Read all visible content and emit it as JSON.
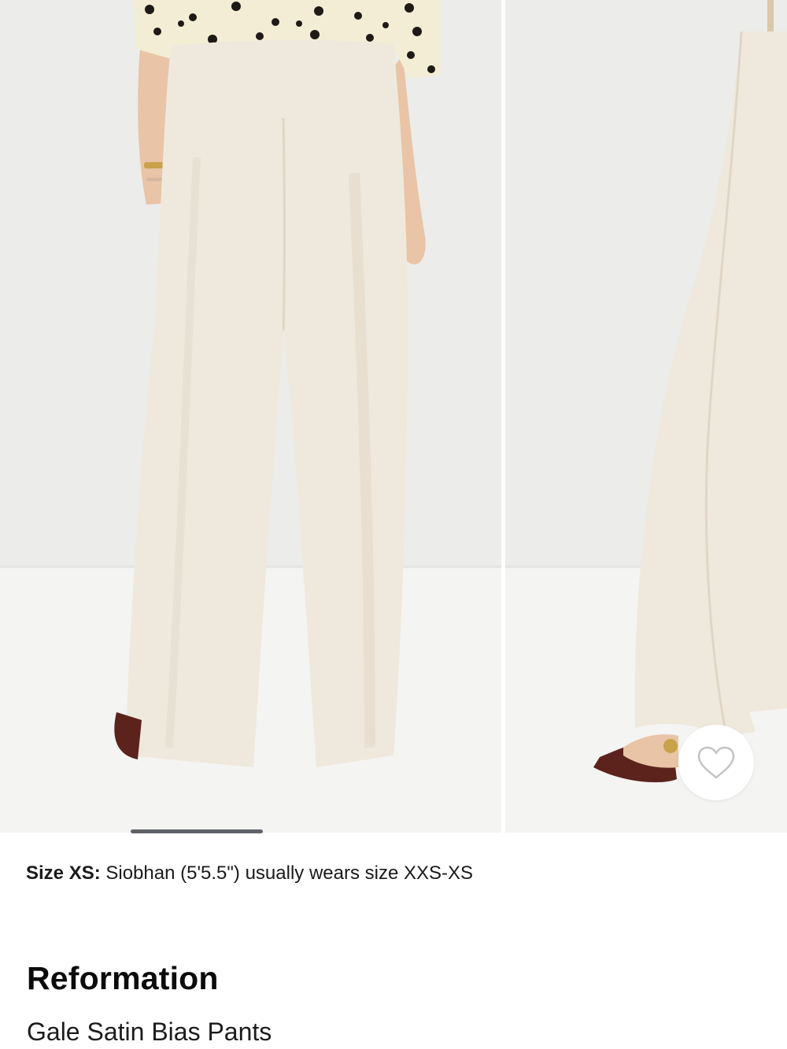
{
  "colors": {
    "background": "#ffffff",
    "wall": "#ececea",
    "floor": "#f4f4f2",
    "pants": "#efe8dc",
    "pants_shade": "#e2d9ca",
    "cardigan": "#f3edd6",
    "polka_dot": "#1e1a16",
    "sandal": "#5b231c",
    "skin": "#e9c4a6",
    "indicator": "#5f6368",
    "heart_stroke": "#c4c4c4"
  },
  "gallery": {
    "images": [
      {
        "label": "Model wearing pants, back view"
      },
      {
        "label": "Model wearing pants, side view"
      }
    ],
    "favorite_icon": "heart-outline-icon"
  },
  "fit_note": {
    "label": "Size XS:",
    "text": " Siobhan (5'5.5\") usually wears size XXS-XS"
  },
  "product": {
    "brand": "Reformation",
    "name": "Gale Satin Bias Pants"
  }
}
